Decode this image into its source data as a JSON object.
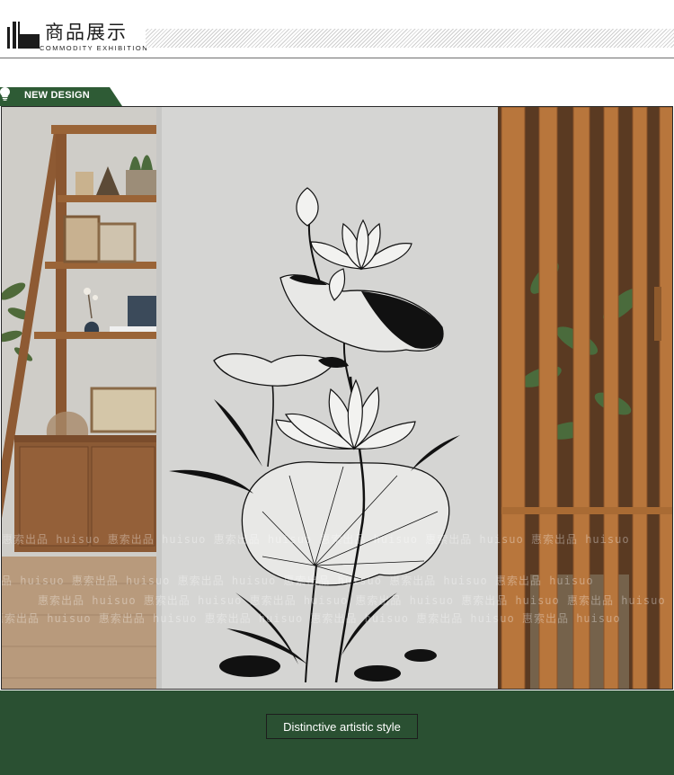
{
  "header": {
    "title_zh": "商品展示",
    "title_en": "COMMODITY EXHIBITION"
  },
  "badge": {
    "label": "NEW DESIGN",
    "icon": "lightbulb-icon"
  },
  "photo": {
    "watermark_text": "惠索出品 huisuo"
  },
  "footer": {
    "caption": "Distinctive artistic style"
  },
  "colors": {
    "brand_green": "#2a5032",
    "badge_green": "#2e5b35",
    "wall": "#d7d7d5",
    "wood": "#b8763c"
  }
}
